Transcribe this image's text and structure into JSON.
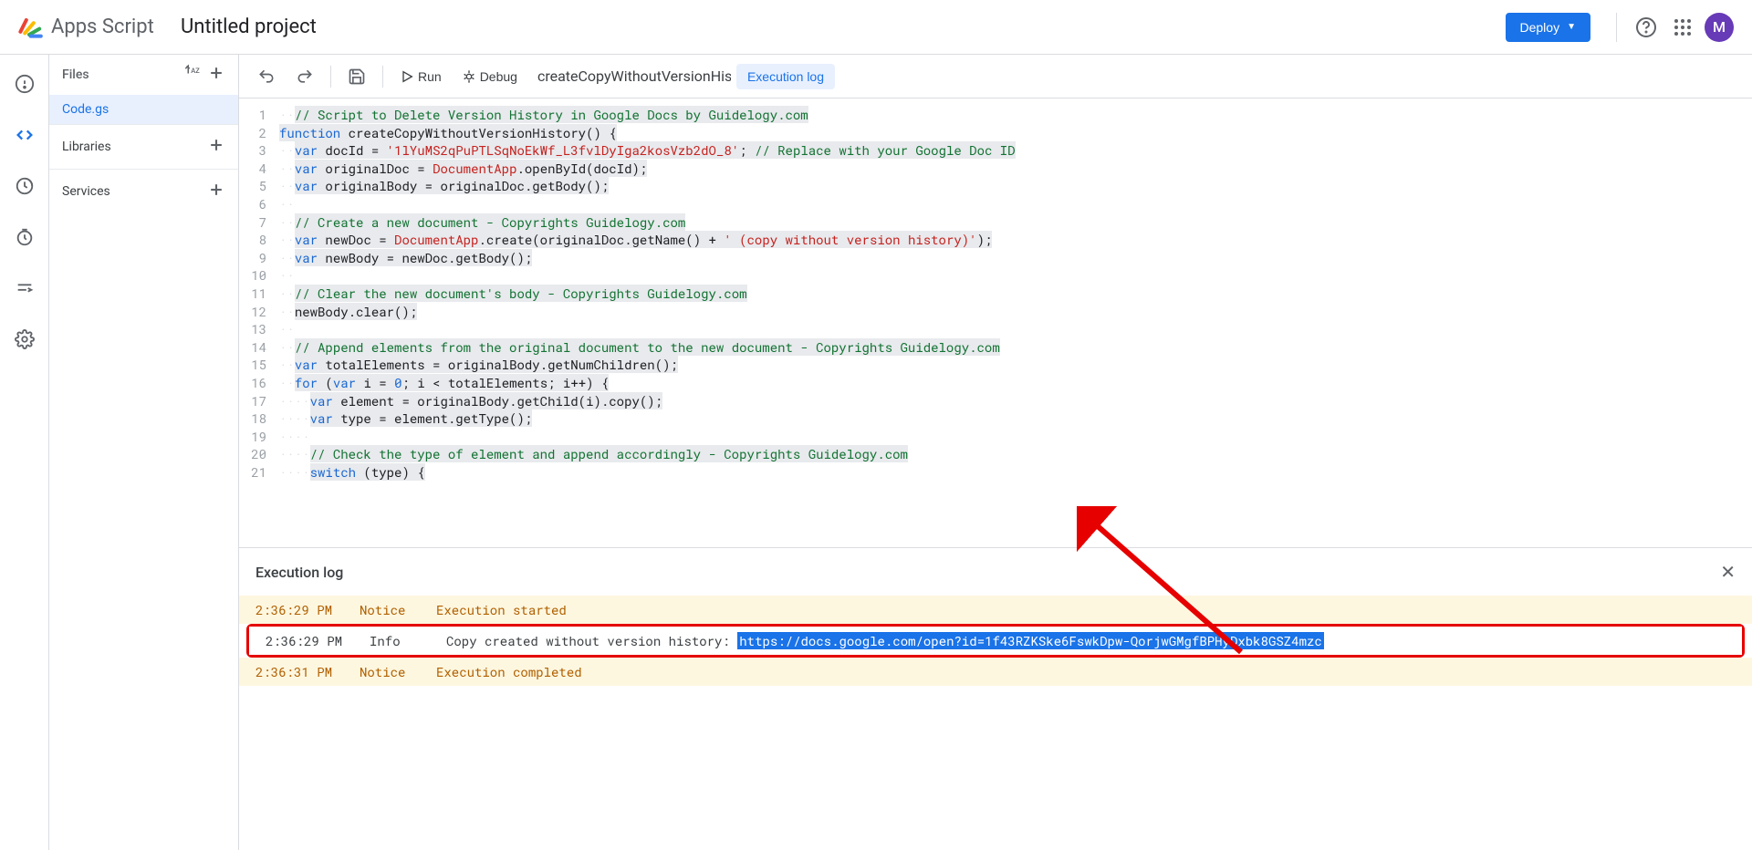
{
  "header": {
    "app_name": "Apps Script",
    "project_title": "Untitled project",
    "deploy_label": "Deploy",
    "avatar_letter": "M"
  },
  "files_panel": {
    "files_label": "Files",
    "file_name": "Code.gs",
    "libraries_label": "Libraries",
    "services_label": "Services"
  },
  "toolbar": {
    "run_label": "Run",
    "debug_label": "Debug",
    "function_name": "createCopyWithoutVersionHist...",
    "exec_log_label": "Execution log"
  },
  "code": {
    "lines": [
      {
        "n": 1,
        "indent": "··",
        "comment": "// Script to Delete Version History in Google Docs by Guidelogy.com"
      },
      {
        "n": 2,
        "raw": "function createCopyWithoutVersionHistory() {"
      },
      {
        "n": 3,
        "indent": "··",
        "raw": "var docId = '1lYuMS2qPuPTLSqNoEkWf_L3fvlDyIga2kosVzb2dO_8'; // Replace with your Google Doc ID"
      },
      {
        "n": 4,
        "indent": "··",
        "raw": "var originalDoc = DocumentApp.openById(docId);"
      },
      {
        "n": 5,
        "indent": "··",
        "raw": "var originalBody = originalDoc.getBody();"
      },
      {
        "n": 6,
        "indent": "··",
        "raw": ""
      },
      {
        "n": 7,
        "indent": "··",
        "comment": "// Create a new document - Copyrights Guidelogy.com"
      },
      {
        "n": 8,
        "indent": "··",
        "raw": "var newDoc = DocumentApp.create(originalDoc.getName() + ' (copy without version history)');"
      },
      {
        "n": 9,
        "indent": "··",
        "raw": "var newBody = newDoc.getBody();"
      },
      {
        "n": 10,
        "indent": "··",
        "raw": ""
      },
      {
        "n": 11,
        "indent": "··",
        "comment": "// Clear the new document's body - Copyrights Guidelogy.com"
      },
      {
        "n": 12,
        "indent": "··",
        "raw": "newBody.clear();"
      },
      {
        "n": 13,
        "indent": "··",
        "raw": ""
      },
      {
        "n": 14,
        "indent": "··",
        "comment": "// Append elements from the original document to the new document - Copyrights Guidelogy.com"
      },
      {
        "n": 15,
        "indent": "··",
        "raw": "var totalElements = originalBody.getNumChildren();"
      },
      {
        "n": 16,
        "indent": "··",
        "raw": "for (var i = 0; i < totalElements; i++) {"
      },
      {
        "n": 17,
        "indent": "····",
        "raw": "var element = originalBody.getChild(i).copy();"
      },
      {
        "n": 18,
        "indent": "····",
        "raw": "var type = element.getType();"
      },
      {
        "n": 19,
        "indent": "····",
        "raw": ""
      },
      {
        "n": 20,
        "indent": "····",
        "comment": "// Check the type of element and append accordingly - Copyrights Guidelogy.com"
      },
      {
        "n": 21,
        "indent": "····",
        "raw": "switch (type) {"
      }
    ]
  },
  "exec_log": {
    "title": "Execution log",
    "rows": [
      {
        "time": "2:36:29 PM",
        "level": "Notice",
        "msg": "Execution started",
        "type": "notice"
      },
      {
        "time": "2:36:29 PM",
        "level": "Info",
        "msg_prefix": "Copy created without version history: ",
        "link": "https://docs.google.com/open?id=1f43RZKSke6FswkDpw-QorjwGMgfBPHyDxbk8GSZ4mzc",
        "type": "info",
        "highlighted": true
      },
      {
        "time": "2:36:31 PM",
        "level": "Notice",
        "msg": "Execution completed",
        "type": "notice"
      }
    ]
  }
}
